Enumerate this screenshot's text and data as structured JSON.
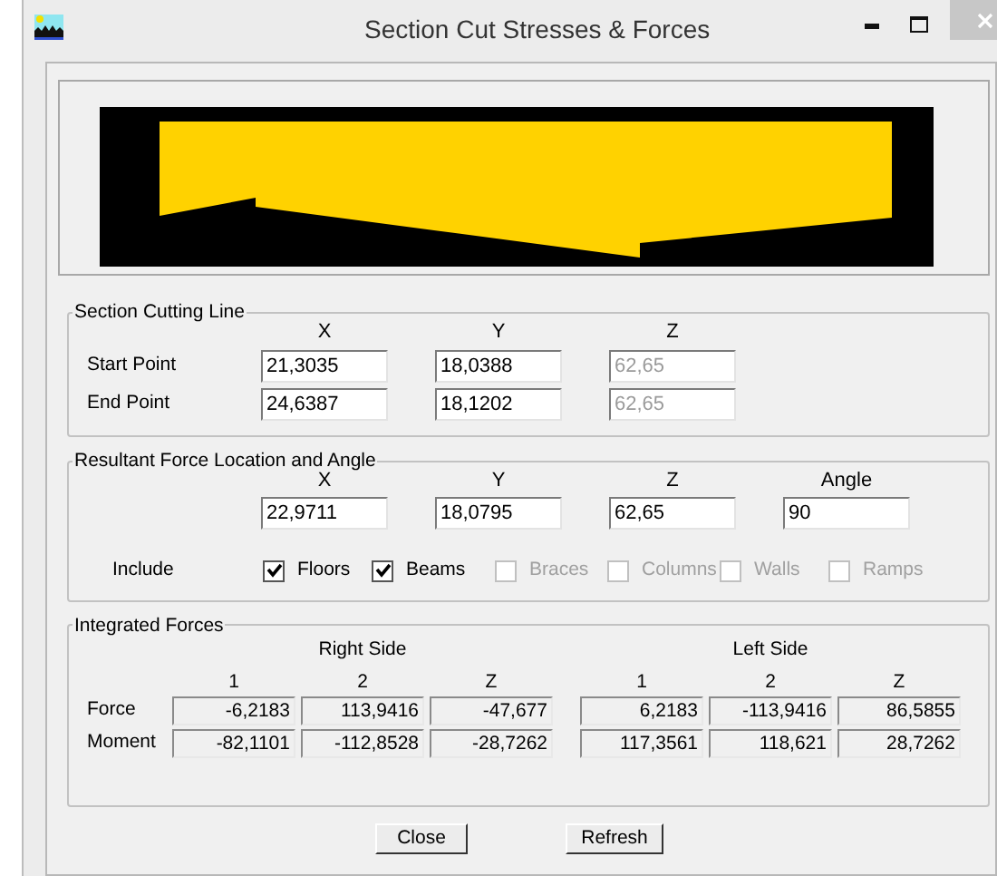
{
  "window": {
    "title": "Section Cut Stresses & Forces"
  },
  "section_cutting_line": {
    "title": "Section Cutting Line",
    "columns": [
      "X",
      "Y",
      "Z"
    ],
    "rows": [
      {
        "label": "Start Point",
        "values": [
          {
            "value": "21,3035",
            "disabled": false
          },
          {
            "value": "18,0388",
            "disabled": false
          },
          {
            "value": "62,65",
            "disabled": true
          }
        ]
      },
      {
        "label": "End Point",
        "values": [
          {
            "value": "24,6387",
            "disabled": false
          },
          {
            "value": "18,1202",
            "disabled": false
          },
          {
            "value": "62,65",
            "disabled": true
          }
        ]
      }
    ]
  },
  "resultant": {
    "title": "Resultant Force Location and Angle",
    "columns": [
      "X",
      "Y",
      "Z",
      "Angle"
    ],
    "values": [
      "22,9711",
      "18,0795",
      "62,65",
      "90"
    ],
    "include_label": "Include",
    "options": [
      {
        "label": "Floors",
        "checked": true,
        "disabled": false
      },
      {
        "label": "Beams",
        "checked": true,
        "disabled": false
      },
      {
        "label": "Braces",
        "checked": false,
        "disabled": true
      },
      {
        "label": "Columns",
        "checked": false,
        "disabled": true
      },
      {
        "label": "Walls",
        "checked": false,
        "disabled": true
      },
      {
        "label": "Ramps",
        "checked": false,
        "disabled": true
      }
    ]
  },
  "integrated_forces": {
    "title": "Integrated Forces",
    "groups": [
      "Right Side",
      "Left Side"
    ],
    "columns": [
      "1",
      "2",
      "Z",
      "1",
      "2",
      "Z"
    ],
    "rows": [
      {
        "label": "Force",
        "values": [
          "-6,2183",
          "113,9416",
          "-47,677",
          "6,2183",
          "-113,9416",
          "86,5855"
        ]
      },
      {
        "label": "Moment",
        "values": [
          "-82,1101",
          "-112,8528",
          "-28,7262",
          "117,3561",
          "118,621",
          "28,7262"
        ]
      }
    ]
  },
  "buttons": [
    "Close",
    "Refresh"
  ]
}
